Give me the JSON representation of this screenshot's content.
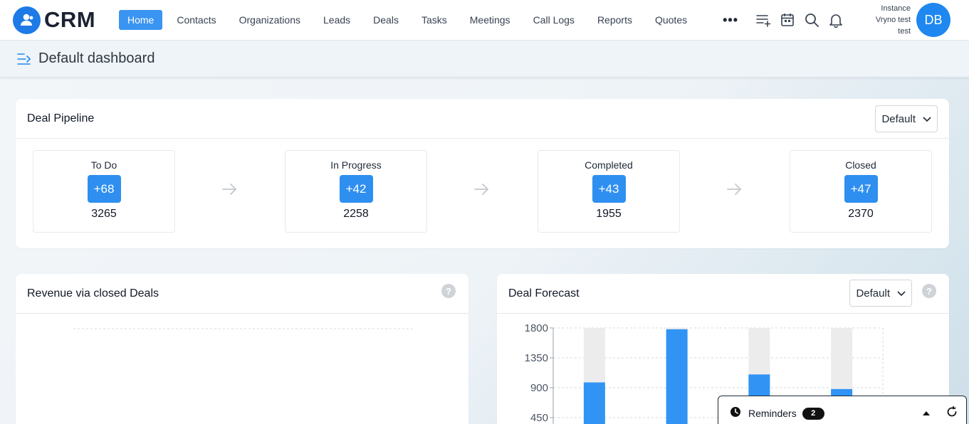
{
  "brand": {
    "name": "CRM"
  },
  "nav": {
    "items": [
      {
        "label": "Home",
        "active": true
      },
      {
        "label": "Contacts"
      },
      {
        "label": "Organizations"
      },
      {
        "label": "Leads"
      },
      {
        "label": "Deals"
      },
      {
        "label": "Tasks"
      },
      {
        "label": "Meetings"
      },
      {
        "label": "Call Logs"
      },
      {
        "label": "Reports"
      },
      {
        "label": "Quotes"
      }
    ],
    "more_label": "•••"
  },
  "toolbar_icons": [
    "add-list-icon",
    "calendar-icon",
    "search-icon",
    "bell-icon"
  ],
  "user": {
    "instance_line1": "Instance",
    "instance_line2": "Vryno test",
    "instance_line3": "test",
    "initials": "DB"
  },
  "page": {
    "title": "Default dashboard"
  },
  "pipeline": {
    "title": "Deal Pipeline",
    "dropdown": "Default",
    "stages": [
      {
        "name": "To Do",
        "delta": "+68",
        "count": "3265"
      },
      {
        "name": "In Progress",
        "delta": "+42",
        "count": "2258"
      },
      {
        "name": "Completed",
        "delta": "+43",
        "count": "1955"
      },
      {
        "name": "Closed",
        "delta": "+47",
        "count": "2370"
      }
    ]
  },
  "revenue": {
    "title": "Revenue via closed Deals",
    "help": "?"
  },
  "forecast": {
    "title": "Deal Forecast",
    "dropdown": "Default",
    "help": "?"
  },
  "chart_data": {
    "type": "bar",
    "title": "Deal Forecast",
    "yticks": [
      1800,
      1350,
      900,
      450
    ],
    "ylim": [
      0,
      1800
    ],
    "grid": true,
    "series": [
      {
        "values": [
          1800,
          1800,
          1800,
          1800
        ]
      },
      {
        "values": [
          980,
          1780,
          1100,
          880
        ]
      }
    ],
    "colors": {
      "track": "#ececec",
      "bar": "#3194f5"
    }
  },
  "reminders": {
    "label": "Reminders",
    "count": "2"
  }
}
